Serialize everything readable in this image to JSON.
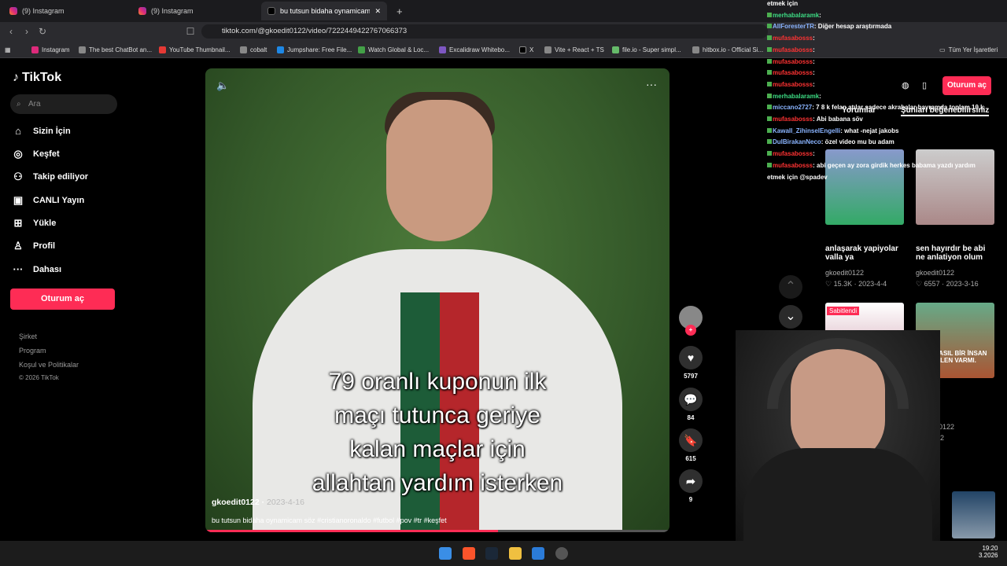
{
  "tabs": [
    {
      "label": "(9) Instagram"
    },
    {
      "label": "(9) Instagram"
    },
    {
      "label": "bu tutsun bidaha oynamicam sö"
    }
  ],
  "url": "tiktok.com/@gkoedit0122/video/7222449422767066373",
  "bookmarks": [
    "Instagram",
    "The best ChatBot an...",
    "YouTube Thumbnail...",
    "cobalt",
    "Jumpshare: Free File...",
    "Watch Global & Loc...",
    "Excalidraw Whitebo...",
    "X",
    "Vite + React + TS",
    "file.io - Super simpl...",
    "hitbox.io - Official Si...",
    "Tüm Yer İşaretleri"
  ],
  "sidebar": {
    "logo": "TikTok",
    "search_placeholder": "Ara",
    "items": [
      "Sizin İçin",
      "Keşfet",
      "Takip ediliyor",
      "CANLI Yayın",
      "Yükle",
      "Profil",
      "Dahası"
    ],
    "login": "Oturum aç",
    "footer": [
      "Şirket",
      "Program",
      "Koşul ve Politikalar",
      "© 2026 TikTok"
    ]
  },
  "video": {
    "caption": [
      "79 oranlı kuponun ilk",
      "maçı tutunca geriye",
      "kalan maçlar için",
      "allahtan yardım isterken"
    ],
    "user": "gkoedit0122",
    "date": "2023-4-16",
    "desc": "bu tutsun bidaha oynamicam söz #cristianoronaldo #futbol #pov #tr #keşfet",
    "progress": 0.63
  },
  "actions": {
    "likes": "5797",
    "comments": "84",
    "saves": "615",
    "shares": "9"
  },
  "chat": [
    {
      "user": "",
      "msg": "etmek için"
    },
    {
      "user": "merhabalaramk",
      "msg": ": "
    },
    {
      "user": "AllForesterTR",
      "msg": ": Diğer hesap araştırmada"
    },
    {
      "user": "mufasabosss",
      "msg": ": "
    },
    {
      "user": "mufasabosss",
      "msg": ": "
    },
    {
      "user": "mufasabosss",
      "msg": ": "
    },
    {
      "user": "mufasabosss",
      "msg": ": "
    },
    {
      "user": "mufasabosss",
      "msg": ": "
    },
    {
      "user": "merhabalaramk",
      "msg": ": "
    },
    {
      "user": "miccano2727",
      "msg": ": 7 8 k felan atılar sadece akrabalar bayramda toplam 10 k"
    },
    {
      "user": "mufasabosss",
      "msg": ": Abi babana söv"
    },
    {
      "user": "Kawall_ZihinselEngelli",
      "msg": ": what -nejat jakobs"
    },
    {
      "user": "DulBirakanNeco",
      "msg": ": özel video mu bu adam"
    },
    {
      "user": "mufasabosss",
      "msg": ": "
    },
    {
      "user": "mufasabosss",
      "msg": ": abi geçen ay zora girdik herkes babama yazdı yardım"
    },
    {
      "user": "",
      "msg": "etmek için @spadev"
    }
  ],
  "right": {
    "login": "Oturum aç",
    "tabs": [
      "Yorumlar",
      "Şunları beğenebilirsiniz"
    ],
    "pinned": "Sabitlendi",
    "thumb_text": "BU NASIL BİR İNSAN BİLEN VARMI.",
    "videos": [
      {
        "title": "anlaşarak yapiyolar valla ya",
        "user": "gkoedit0122",
        "likes": "15.3K",
        "date": "2023-4-4"
      },
      {
        "title": "sen hayırdır be abi ne anlatiyon olum",
        "user": "gkoedit0122",
        "likes": "6557",
        "date": "2023-3-16"
      },
      {
        "title": "",
        "user": "gkoedit0122",
        "likes": "",
        "date": "2025-4-2"
      }
    ]
  },
  "clock": {
    "time": "19:20",
    "date": "3.2026"
  }
}
